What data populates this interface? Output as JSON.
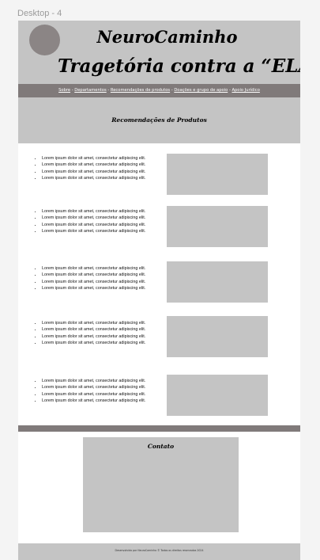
{
  "frame": {
    "label": "Desktop - 4"
  },
  "header": {
    "title_line1": "NeuroCaminho",
    "title_line2": "Tragetória contra a “ELA”"
  },
  "nav": {
    "items": [
      "Sobre",
      "Departamentos",
      "Recomendações de produtos",
      "Doações e grupo de apoio",
      "Apoio Jurídico"
    ],
    "separator": " - "
  },
  "products_section": {
    "title": "Recomendações de Produtos"
  },
  "products": [
    {
      "items": [
        "Lorem ipsum dolor sit amet, consectetur adipiscing elit.",
        "Lorem ipsum dolor sit amet, consectetur adipiscing elit.",
        "Lorem ipsum dolor sit amet, consectetur adipiscing elit.",
        "Lorem ipsum dolor sit amet, consectetur adipiscing elit."
      ]
    },
    {
      "items": [
        "Lorem ipsum dolor sit amet, consectetur adipiscing elit.",
        "Lorem ipsum dolor sit amet, consectetur adipiscing elit.",
        "Lorem ipsum dolor sit amet, consectetur adipiscing elit.",
        "Lorem ipsum dolor sit amet, consectetur adipiscing elit."
      ]
    },
    {
      "items": [
        "Lorem ipsum dolor sit amet, consectetur adipiscing elit.",
        "Lorem ipsum dolor sit amet, consectetur adipiscing elit.",
        "Lorem ipsum dolor sit amet, consectetur adipiscing elit.",
        "Lorem ipsum dolor sit amet, consectetur adipiscing elit."
      ]
    },
    {
      "items": [
        "Lorem ipsum dolor sit amet, consectetur adipiscing elit.",
        "Lorem ipsum dolor sit amet, consectetur adipiscing elit.",
        "Lorem ipsum dolor sit amet, consectetur adipiscing elit.",
        "Lorem ipsum dolor sit amet, consectetur adipiscing elit."
      ]
    },
    {
      "items": [
        "Lorem ipsum dolor sit amet, consectetur adipiscing elit.",
        "Lorem ipsum dolor sit amet, consectetur adipiscing elit.",
        "Lorem ipsum dolor sit amet, consectetur adipiscing elit.",
        "Lorem ipsum dolor sit amet, consectetur adipiscing elit."
      ]
    }
  ],
  "contact": {
    "title": "Contato"
  },
  "footer": {
    "text": "Desenvolvido por NeuroCaminho © Todos os direitos reservados 2024"
  },
  "colors": {
    "header_bg": "#c4c4c4",
    "nav_bg": "#807a7a",
    "logo": "#8b8585"
  }
}
